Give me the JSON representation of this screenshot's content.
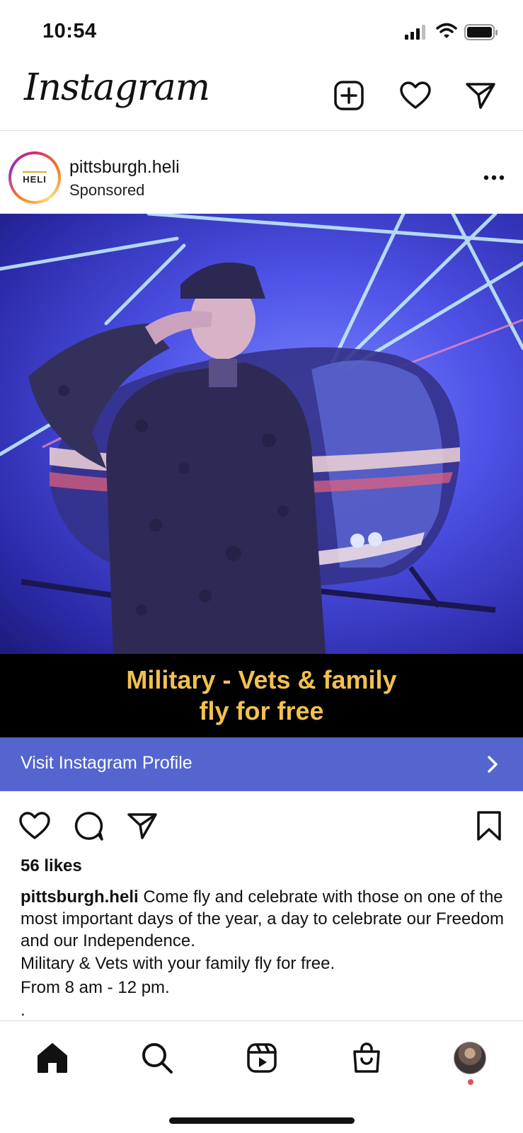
{
  "status_bar": {
    "time": "10:54",
    "icons": [
      "cellular-signal-icon",
      "wifi-icon",
      "battery-icon"
    ]
  },
  "header": {
    "logo": "Instagram",
    "icons": [
      "plus-square-icon",
      "heart-icon",
      "paper-plane-icon"
    ]
  },
  "post": {
    "username": "pittsburgh.heli",
    "subtitle": "Sponsored",
    "avatar_text": "HELI",
    "banner": {
      "line1": "Military - Vets & family",
      "line2": "fly for free"
    },
    "cta_label": "Visit Instagram Profile",
    "likes": "56 likes",
    "caption": {
      "username": "pittsburgh.heli",
      "text": "Come fly and celebrate with those on one of the most important days of the year, a day to celebrate our Freedom and our Independence.",
      "line2": "Military & Vets with your family fly for free.",
      "line3": "From 8 am - 12 pm.",
      "line4": "."
    }
  },
  "bottom_nav": {
    "items": [
      "home-icon",
      "search-icon",
      "reels-icon",
      "shop-icon",
      "profile-avatar"
    ]
  },
  "colors": {
    "cta": "#5565cf",
    "banner_text": "#f2c04f",
    "notification_dot": "#ed4956"
  }
}
